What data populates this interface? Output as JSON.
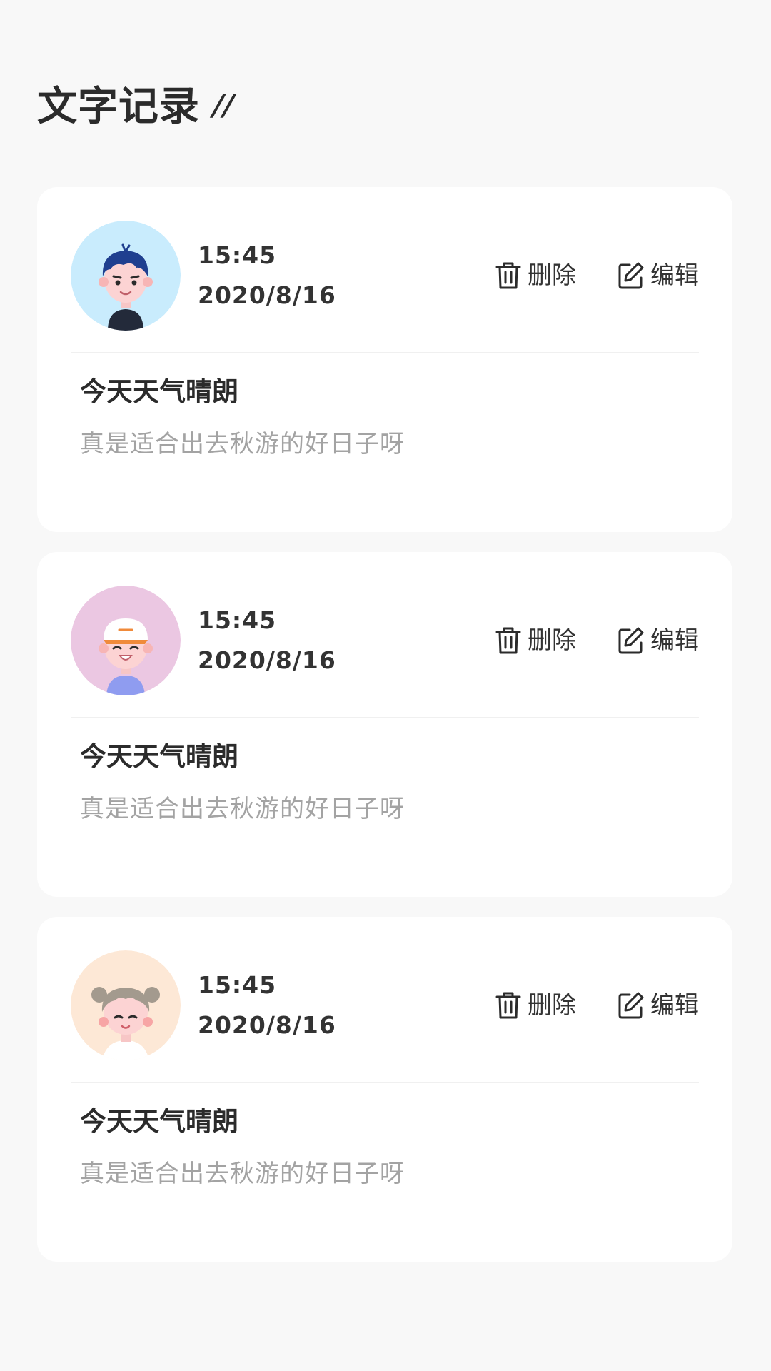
{
  "page": {
    "title": "文字记录",
    "title_decoration": "//"
  },
  "colors": {
    "background": "#f8f8f8",
    "card": "#ffffff",
    "primary_text": "#333333",
    "secondary_text": "#a3a3a3"
  },
  "records": [
    {
      "avatar": "boy-blue-hair-avatar",
      "avatar_bg": "#c9ecfd",
      "time": "15:45",
      "date": "2020/8/16",
      "delete_label": "删除",
      "edit_label": "编辑",
      "title": "今天天气晴朗",
      "text": "真是适合出去秋游的好日子呀"
    },
    {
      "avatar": "boy-white-cap-avatar",
      "avatar_bg": "#ebc7e2",
      "time": "15:45",
      "date": "2020/8/16",
      "delete_label": "删除",
      "edit_label": "编辑",
      "title": "今天天气晴朗",
      "text": "真是适合出去秋游的好日子呀"
    },
    {
      "avatar": "girl-buns-avatar",
      "avatar_bg": "#fde8d6",
      "time": "15:45",
      "date": "2020/8/16",
      "delete_label": "删除",
      "edit_label": "编辑",
      "title": "今天天气晴朗",
      "text": "真是适合出去秋游的好日子呀"
    }
  ]
}
